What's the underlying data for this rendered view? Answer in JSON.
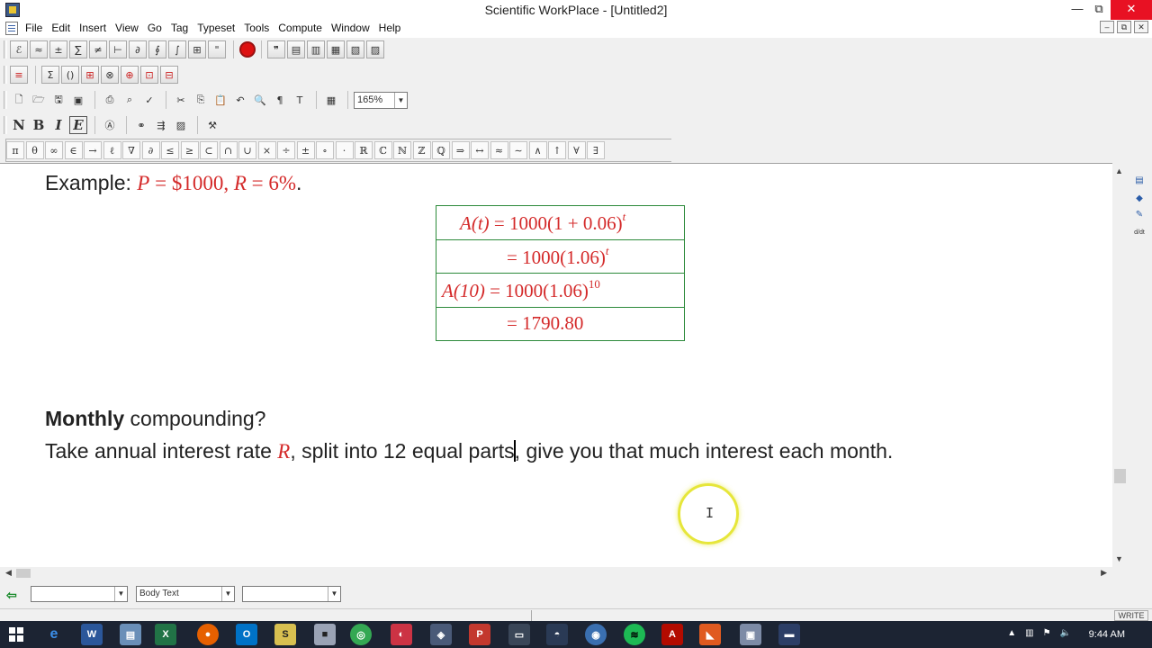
{
  "window": {
    "title": "Scientific WorkPlace - [Untitled2]",
    "minimize": "—",
    "restore": "⧉",
    "close": "✕"
  },
  "menu": [
    "File",
    "Edit",
    "Insert",
    "View",
    "Go",
    "Tag",
    "Typeset",
    "Tools",
    "Compute",
    "Window",
    "Help"
  ],
  "mdi": [
    "–",
    "⧉",
    "✕"
  ],
  "toolbar": {
    "zoom": "165%",
    "text_buttons": [
      "N",
      "B",
      "I",
      "E"
    ]
  },
  "symbols": [
    "π",
    "θ",
    "∞",
    "∈",
    "→",
    "ℓ",
    "∇",
    "∂",
    "≤",
    "≥",
    "⊂",
    "∩",
    "∪",
    "×",
    "÷",
    "±",
    "∘",
    "·",
    "ℝ",
    "ℂ",
    "ℕ",
    "ℤ",
    "ℚ",
    "⇒",
    "↔",
    "≈",
    "∼",
    "∧",
    "↑",
    "∀",
    "∃"
  ],
  "document": {
    "example_label": "Example:",
    "example_math": {
      "p_var": "P",
      "p_val": "$1000",
      "r_var": "R",
      "r_val": "6%"
    },
    "equations": [
      {
        "lhs": "A(t)",
        "rhs": "= 1000(1 + 0.06)",
        "sup": "t"
      },
      {
        "lhs": "",
        "rhs": "= 1000(1.06)",
        "sup": "t"
      },
      {
        "lhs": "A(10)",
        "rhs": "= 1000(1.06)",
        "sup": "10"
      },
      {
        "lhs": "",
        "rhs": "= 1790.80",
        "sup": ""
      }
    ],
    "monthly_bold": "Monthly",
    "monthly_rest": "compounding?",
    "take_before": "Take annual interest rate",
    "take_var": "R",
    "take_middle": ", split into 12 equal parts",
    "take_after": ", give you that much interest each month."
  },
  "tagbar": {
    "section_tag": "",
    "body_tag": "Body Text",
    "item_tag": ""
  },
  "status": {
    "mode": "WRITE"
  },
  "taskbar": {
    "time": "9:44 AM"
  }
}
